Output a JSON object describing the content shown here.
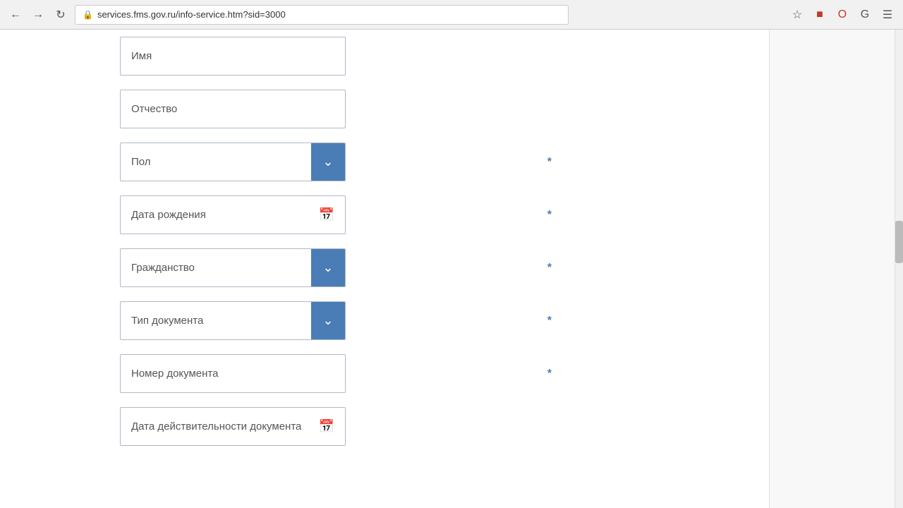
{
  "browser": {
    "url": "services.fms.gov.ru/info-service.htm?sid=3000",
    "back_title": "Back",
    "forward_title": "Forward",
    "reload_title": "Reload"
  },
  "form": {
    "fields": [
      {
        "id": "imya",
        "type": "input",
        "placeholder": "Имя",
        "required": false
      },
      {
        "id": "otchestvo",
        "type": "input",
        "placeholder": "Отчество",
        "required": false
      },
      {
        "id": "pol",
        "type": "select",
        "placeholder": "Пол",
        "required": true
      },
      {
        "id": "data-rozhdeniya",
        "type": "date",
        "placeholder": "Дата рождения",
        "required": true
      },
      {
        "id": "grazhdanstvo",
        "type": "select",
        "placeholder": "Гражданство",
        "required": true
      },
      {
        "id": "tip-dokumenta",
        "type": "select",
        "placeholder": "Тип документа",
        "required": true
      },
      {
        "id": "nomer-dokumenta",
        "type": "input",
        "placeholder": "Номер документа",
        "required": true
      },
      {
        "id": "data-deystvitelnosti",
        "type": "date",
        "placeholder": "Дата действительности документа",
        "required": false
      }
    ]
  }
}
